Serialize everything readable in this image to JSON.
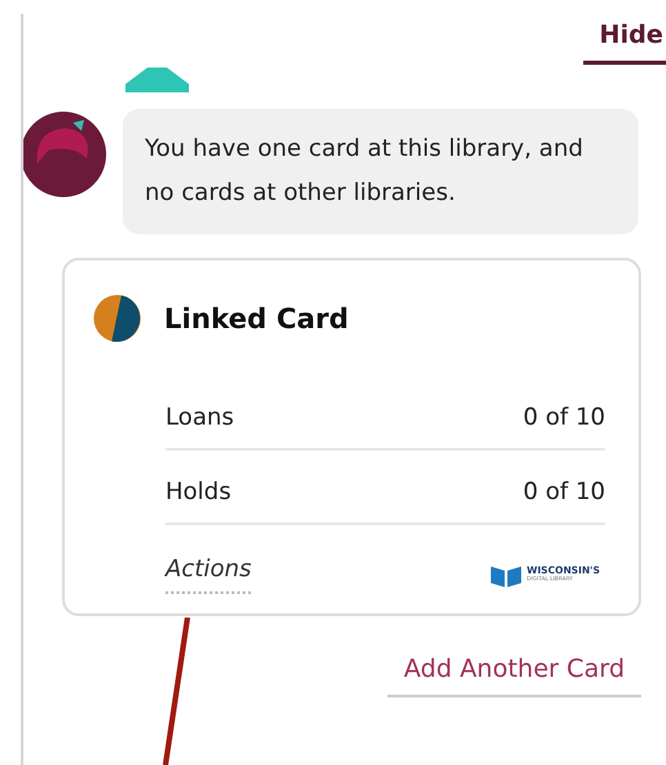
{
  "header": {
    "hide_link": "Hide"
  },
  "message": {
    "text": "You have one card at this library, and no cards at other libraries."
  },
  "card": {
    "title": "Linked Card",
    "rows": [
      {
        "label": "Loans",
        "value": "0 of 10"
      },
      {
        "label": "Holds",
        "value": "0 of 10"
      }
    ],
    "actions_label": "Actions",
    "logo": {
      "line_1": "WISCONSIN'S",
      "line_2": "DIGITAL LIBRARY"
    }
  },
  "add_card_link": "Add Another Card"
}
